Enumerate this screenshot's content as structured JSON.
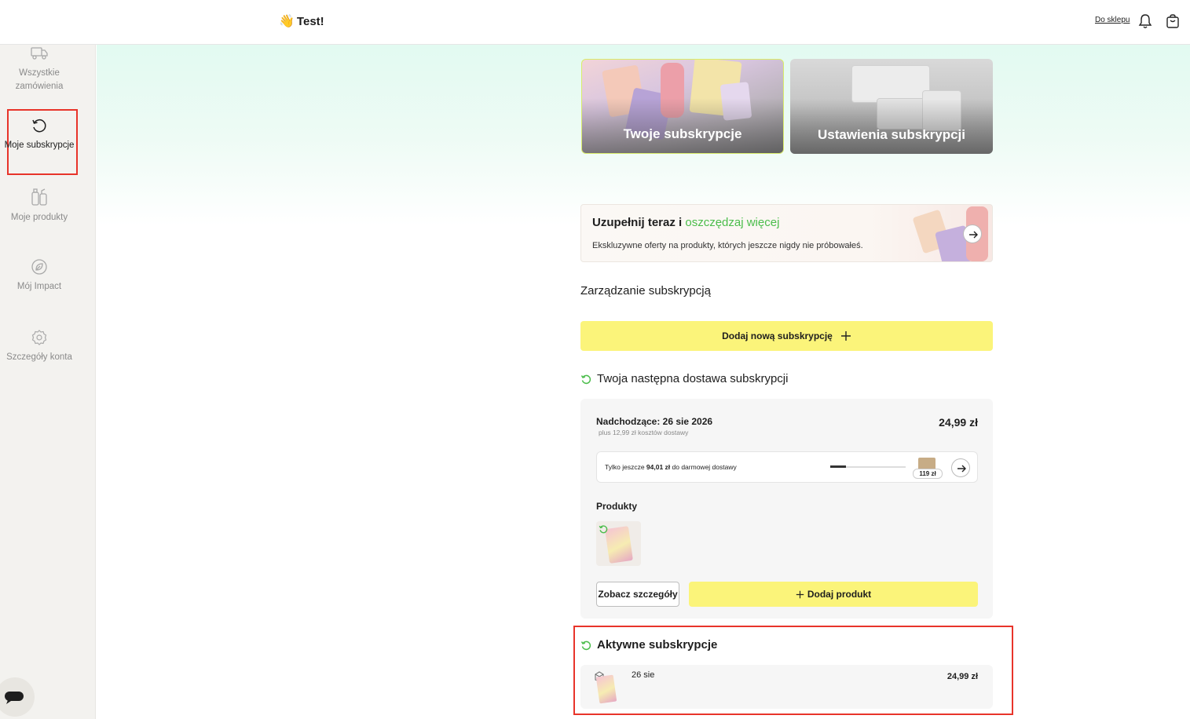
{
  "header": {
    "greeting_emoji": "👋",
    "greeting": "Test!",
    "shop_link": "Do sklepu"
  },
  "sidebar": {
    "items": [
      {
        "label": "Wszystkie zamówienia",
        "icon": "truck-icon"
      },
      {
        "label": "Moje subskrypcje",
        "icon": "refresh-icon",
        "active": true
      },
      {
        "label": "Moje produkty",
        "icon": "bottles-icon"
      },
      {
        "label": "Mój Impact",
        "icon": "leaf-icon"
      },
      {
        "label": "Szczegóły konta",
        "icon": "gear-icon"
      }
    ]
  },
  "tiles": {
    "subscriptions": "Twoje subskrypcje",
    "settings": "Ustawienia subskrypcji"
  },
  "promo": {
    "title_main": "Uzupełnij teraz i ",
    "title_accent": "oszczędzaj więcej",
    "subtitle": "Ekskluzywne oferty na produkty, których jeszcze nigdy nie próbowałeś."
  },
  "management": {
    "heading": "Zarządzanie subskrypcją",
    "add_button": "Dodaj nową subskrypcję"
  },
  "next_delivery": {
    "heading": "Twoja następna dostawa subskrypcji",
    "upcoming": "Nadchodzące: 26 sie 2026",
    "shipping": "plus 12,99 zł kosztów dostawy",
    "price": "24,99 zł",
    "free_prefix": "Tylko jeszcze ",
    "free_amount": "94,01 zł",
    "free_suffix": " do darmowej dostawy",
    "free_progress": 0.21,
    "threshold": "119 zł",
    "products_label": "Produkty",
    "details_button": "Zobacz szczegóły",
    "add_product_button": "Dodaj produkt"
  },
  "active": {
    "heading": "Aktywne subskrypcje",
    "date": "26 sie",
    "price": "24,99 zł"
  },
  "colors": {
    "accent_yellow": "#fbf47a",
    "accent_green": "#4bbd4b",
    "highlight_red": "#e8342a"
  }
}
